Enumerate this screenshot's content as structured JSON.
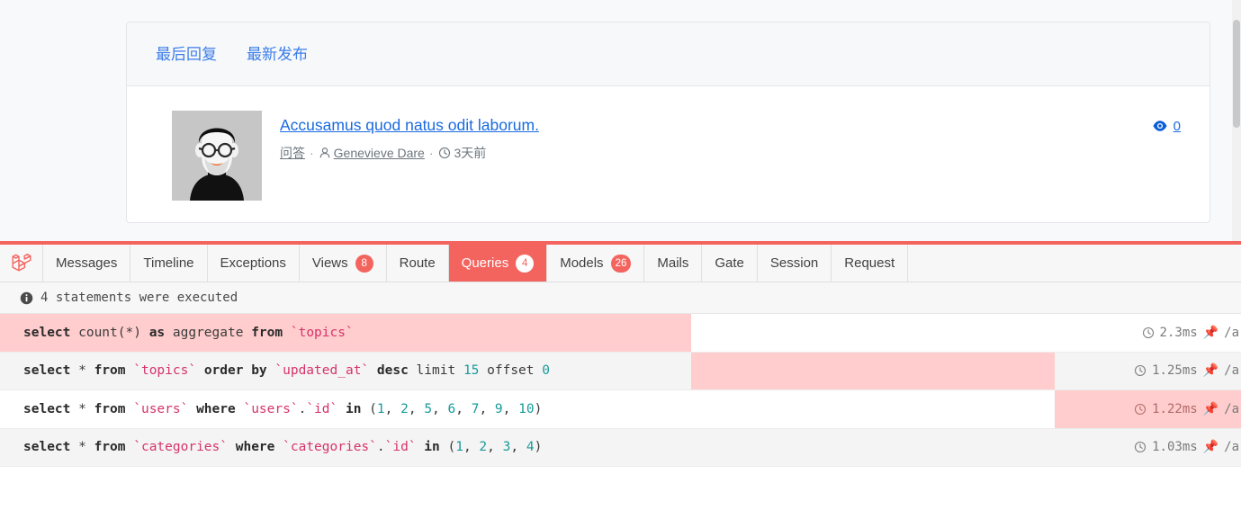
{
  "page": {
    "background": "#f8f9fa",
    "accent": "#f4645f",
    "link_color": "#1a6ae0"
  },
  "card": {
    "nav": [
      {
        "label": "最后回复",
        "name": "last-reply"
      },
      {
        "label": "最新发布",
        "name": "latest-published"
      }
    ],
    "topic": {
      "title": "Accusamus quod natus odit laborum.",
      "category": "问答",
      "author": "Genevieve Dare",
      "time": "3天前",
      "views": "0",
      "separator": "·"
    }
  },
  "debugbar": {
    "tabs": [
      {
        "label": "Messages",
        "badge": null,
        "active": false
      },
      {
        "label": "Timeline",
        "badge": null,
        "active": false
      },
      {
        "label": "Exceptions",
        "badge": null,
        "active": false
      },
      {
        "label": "Views",
        "badge": "8",
        "active": false
      },
      {
        "label": "Route",
        "badge": null,
        "active": false
      },
      {
        "label": "Queries",
        "badge": "4",
        "active": true
      },
      {
        "label": "Models",
        "badge": "26",
        "active": false
      },
      {
        "label": "Mails",
        "badge": null,
        "active": false
      },
      {
        "label": "Gate",
        "badge": null,
        "active": false
      },
      {
        "label": "Session",
        "badge": null,
        "active": false
      },
      {
        "label": "Request",
        "badge": null,
        "active": false
      }
    ],
    "status": "4 statements were executed",
    "queries": [
      {
        "tokens": [
          {
            "t": "select ",
            "c": "kw"
          },
          {
            "t": "count(*) ",
            "c": "pln"
          },
          {
            "t": "as ",
            "c": "kw"
          },
          {
            "t": "aggregate ",
            "c": "pln"
          },
          {
            "t": "from ",
            "c": "kw"
          },
          {
            "t": "`topics`",
            "c": "idt"
          }
        ],
        "duration": "2.3ms",
        "path": "/a",
        "bar_left_pct": 0,
        "bar_width_pct": 55.7
      },
      {
        "tokens": [
          {
            "t": "select ",
            "c": "kw"
          },
          {
            "t": "* ",
            "c": "pln"
          },
          {
            "t": "from ",
            "c": "kw"
          },
          {
            "t": "`topics` ",
            "c": "idt"
          },
          {
            "t": "order by ",
            "c": "kw"
          },
          {
            "t": "`updated_at` ",
            "c": "idt"
          },
          {
            "t": "desc ",
            "c": "kw"
          },
          {
            "t": "limit ",
            "c": "pln"
          },
          {
            "t": "15 ",
            "c": "num"
          },
          {
            "t": "offset ",
            "c": "pln"
          },
          {
            "t": "0",
            "c": "num"
          }
        ],
        "duration": "1.25ms",
        "path": "/a",
        "bar_left_pct": 55.7,
        "bar_width_pct": 29.3
      },
      {
        "tokens": [
          {
            "t": "select ",
            "c": "kw"
          },
          {
            "t": "* ",
            "c": "pln"
          },
          {
            "t": "from ",
            "c": "kw"
          },
          {
            "t": "`users` ",
            "c": "idt"
          },
          {
            "t": "where ",
            "c": "kw"
          },
          {
            "t": "`users`",
            "c": "idt"
          },
          {
            "t": ".",
            "c": "pln"
          },
          {
            "t": "`id` ",
            "c": "idt"
          },
          {
            "t": "in ",
            "c": "kw"
          },
          {
            "t": "(",
            "c": "pln"
          },
          {
            "t": "1",
            "c": "num"
          },
          {
            "t": ", ",
            "c": "pln"
          },
          {
            "t": "2",
            "c": "num"
          },
          {
            "t": ", ",
            "c": "pln"
          },
          {
            "t": "5",
            "c": "num"
          },
          {
            "t": ", ",
            "c": "pln"
          },
          {
            "t": "6",
            "c": "num"
          },
          {
            "t": ", ",
            "c": "pln"
          },
          {
            "t": "7",
            "c": "num"
          },
          {
            "t": ", ",
            "c": "pln"
          },
          {
            "t": "9",
            "c": "num"
          },
          {
            "t": ", ",
            "c": "pln"
          },
          {
            "t": "10",
            "c": "num"
          },
          {
            "t": ")",
            "c": "pln"
          }
        ],
        "duration": "1.22ms",
        "path": "/a",
        "bar_left_pct": 85.0,
        "bar_width_pct": 15.0
      },
      {
        "tokens": [
          {
            "t": "select ",
            "c": "kw"
          },
          {
            "t": "* ",
            "c": "pln"
          },
          {
            "t": "from ",
            "c": "kw"
          },
          {
            "t": "`categories` ",
            "c": "idt"
          },
          {
            "t": "where ",
            "c": "kw"
          },
          {
            "t": "`categories`",
            "c": "idt"
          },
          {
            "t": ".",
            "c": "pln"
          },
          {
            "t": "`id` ",
            "c": "idt"
          },
          {
            "t": "in ",
            "c": "kw"
          },
          {
            "t": "(",
            "c": "pln"
          },
          {
            "t": "1",
            "c": "num"
          },
          {
            "t": ", ",
            "c": "pln"
          },
          {
            "t": "2",
            "c": "num"
          },
          {
            "t": ", ",
            "c": "pln"
          },
          {
            "t": "3",
            "c": "num"
          },
          {
            "t": ", ",
            "c": "pln"
          },
          {
            "t": "4",
            "c": "num"
          },
          {
            "t": ")",
            "c": "pln"
          }
        ],
        "duration": "1.03ms",
        "path": "/a",
        "bar_left_pct": 100,
        "bar_width_pct": 0
      }
    ]
  },
  "icons": {
    "brand": "laravel-logo-icon",
    "info": "info-icon",
    "clock": "clock-icon",
    "pin": "pin-icon",
    "user": "user-icon",
    "eye": "eye-icon"
  }
}
